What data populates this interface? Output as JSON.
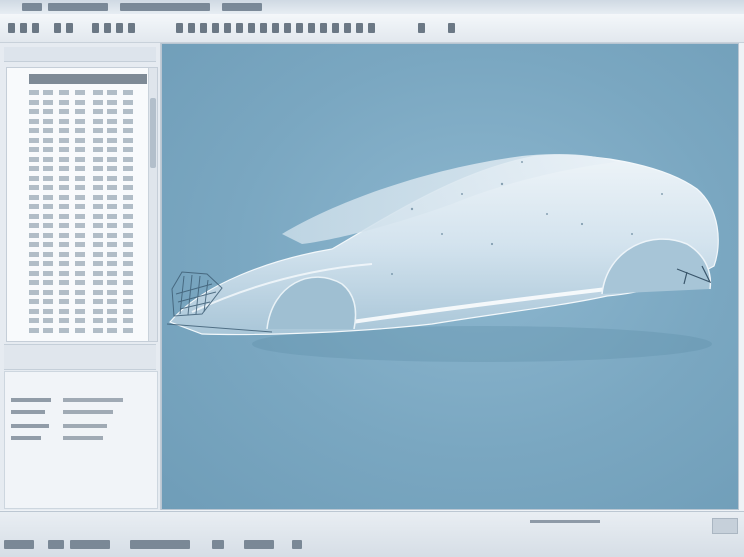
{
  "window": {
    "title": ""
  },
  "toolbar": {
    "icons": [
      "file-icon",
      "open-icon",
      "save-icon",
      "undo-icon",
      "redo-icon",
      "select-icon",
      "move-icon",
      "rotate-icon",
      "scale-icon",
      "mesh-icon",
      "render-icon",
      "view-icon"
    ]
  },
  "viewport": {
    "model": "car-body-3d-mesh"
  },
  "colors": {
    "viewport_bg": "#7aa7c1",
    "model_surface": "#dbe8f1",
    "chrome": "#e6ebf1"
  },
  "statusbar": {
    "icons": [
      "status-icon-1",
      "status-icon-2",
      "status-icon-3",
      "status-icon-4"
    ]
  }
}
